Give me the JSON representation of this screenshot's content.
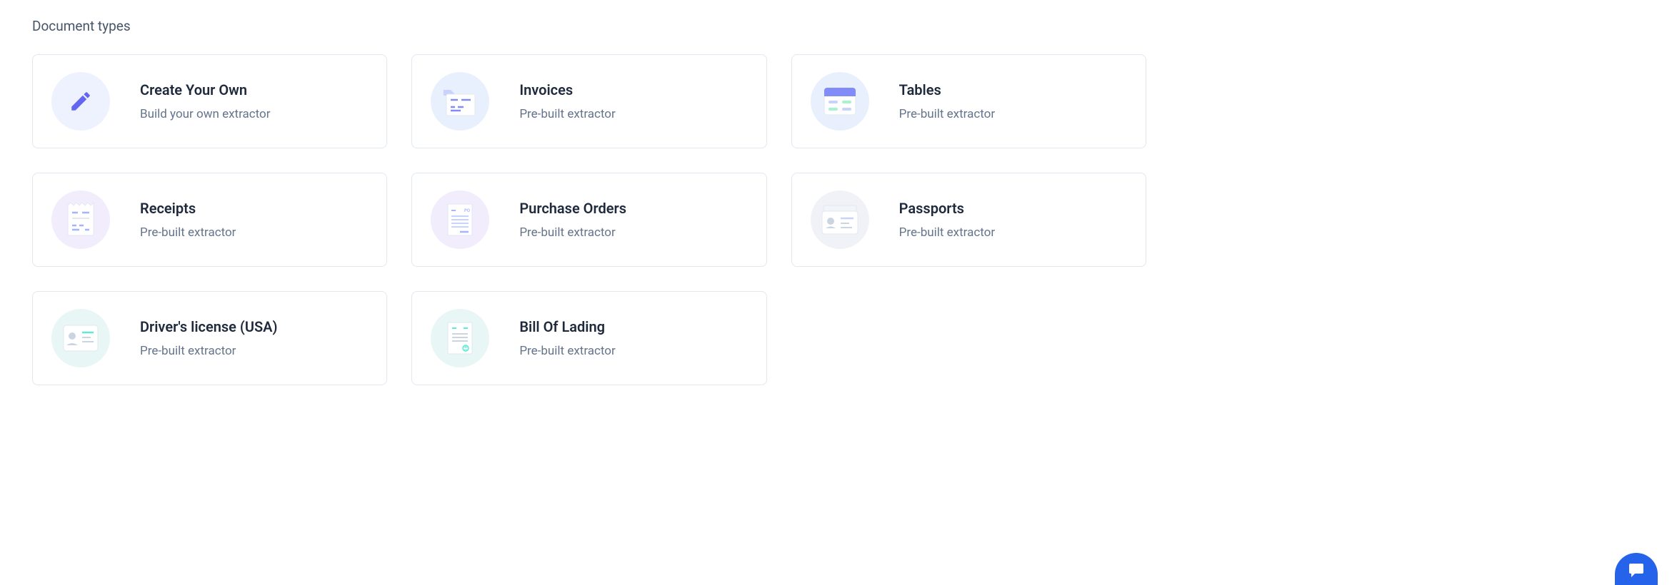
{
  "section_title": "Document types",
  "cards": [
    {
      "title": "Create Your Own",
      "subtitle": "Build your own extractor"
    },
    {
      "title": "Invoices",
      "subtitle": "Pre-built extractor"
    },
    {
      "title": "Tables",
      "subtitle": "Pre-built extractor"
    },
    {
      "title": "Receipts",
      "subtitle": "Pre-built extractor"
    },
    {
      "title": "Purchase Orders",
      "subtitle": "Pre-built extractor"
    },
    {
      "title": "Passports",
      "subtitle": "Pre-built extractor"
    },
    {
      "title": "Driver's license (USA)",
      "subtitle": "Pre-built extractor"
    },
    {
      "title": "Bill Of Lading",
      "subtitle": "Pre-built extractor"
    }
  ]
}
